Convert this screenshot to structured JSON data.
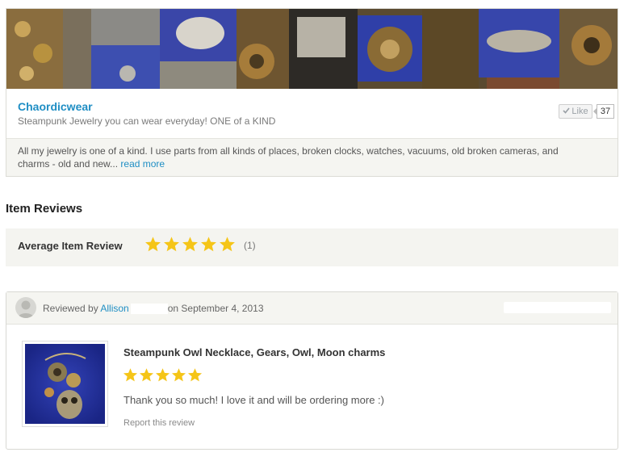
{
  "shop": {
    "name": "Chaordicwear",
    "tagline": "Steampunk Jewelry you can wear everyday! ONE of a KIND",
    "like_label": "Like",
    "like_count": "37",
    "about": "All my jewelry is one of a kind. I use parts from all kinds of places, broken clocks, watches, vacuums, old broken cameras, and charms - old and new...",
    "read_more": "read more"
  },
  "reviews": {
    "title": "Item Reviews",
    "average_label": "Average Item Review",
    "average_rating": 5,
    "average_max": 5,
    "count_label": "(1)"
  },
  "review": {
    "reviewed_by_prefix": "Reviewed by",
    "reviewer": "Allison",
    "date_text": "on September 4, 2013",
    "item_title": "Steampunk Owl Necklace, Gears, Owl, Moon charms",
    "rating": 5,
    "rating_max": 5,
    "text": "Thank you so much! I love it and will be ordering more :)",
    "report_label": "Report this review"
  },
  "colors": {
    "link": "#1f8ec4",
    "star": "#f5c518",
    "panel_bg": "#f4f4f0"
  },
  "icons": {
    "like": "check-icon",
    "star": "star-icon",
    "avatar": "user-silhouette-icon"
  }
}
